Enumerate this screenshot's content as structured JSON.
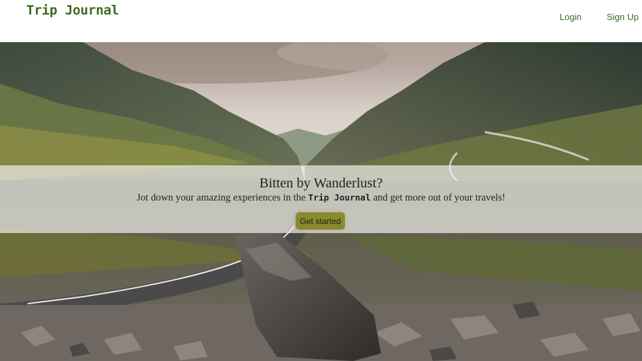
{
  "navbar": {
    "brand": "Trip Journal",
    "links": [
      {
        "label": "Login"
      },
      {
        "label": "Sign Up"
      }
    ]
  },
  "hero": {
    "title": "Bitten by Wanderlust?",
    "subtitle_before": "Jot down your amazing experiences in the ",
    "subtitle_brand": "Trip Journal",
    "subtitle_after": " and get more out of your travels!",
    "cta_label": "Get started"
  },
  "colors": {
    "brand": "#3d6b1f",
    "cta": "#8a8a2e"
  }
}
